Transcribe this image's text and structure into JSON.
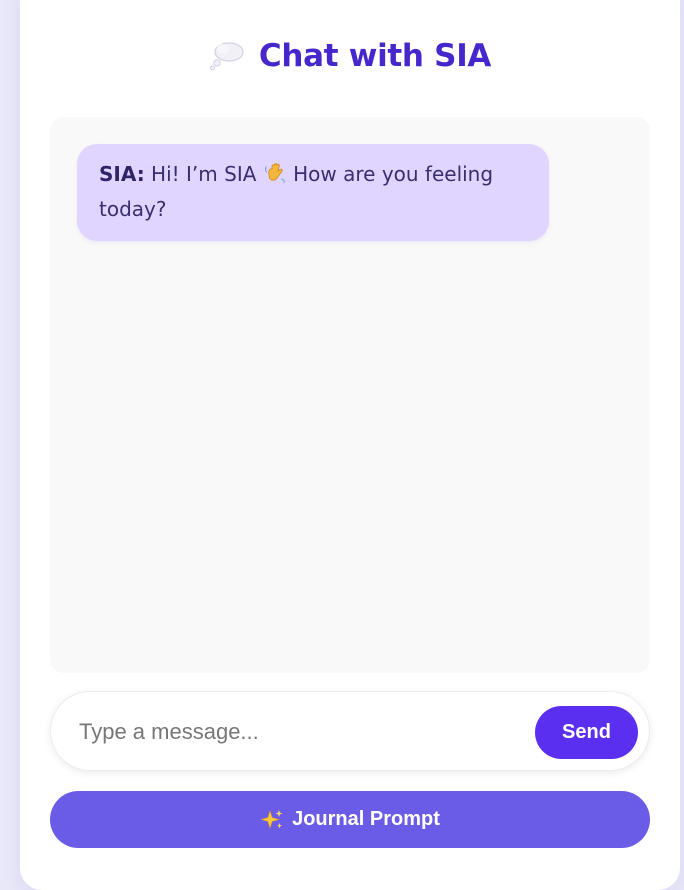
{
  "header": {
    "icon": "thought-bubble-icon",
    "title": "Chat with SIA"
  },
  "messages": [
    {
      "sender": "SIA:",
      "text_before": " Hi! I’m SIA ",
      "emoji": "waving-hand-icon",
      "text_after": " How are you feeling today?"
    }
  ],
  "composer": {
    "placeholder": "Type a message...",
    "send_label": "Send"
  },
  "journal": {
    "icon": "sparkles-icon",
    "label": "Journal Prompt"
  },
  "colors": {
    "accent": "#4527cc",
    "send_button": "#5a2ff0",
    "journal_button": "#6b5ce7",
    "bubble_bg": "#e0d5ff"
  }
}
